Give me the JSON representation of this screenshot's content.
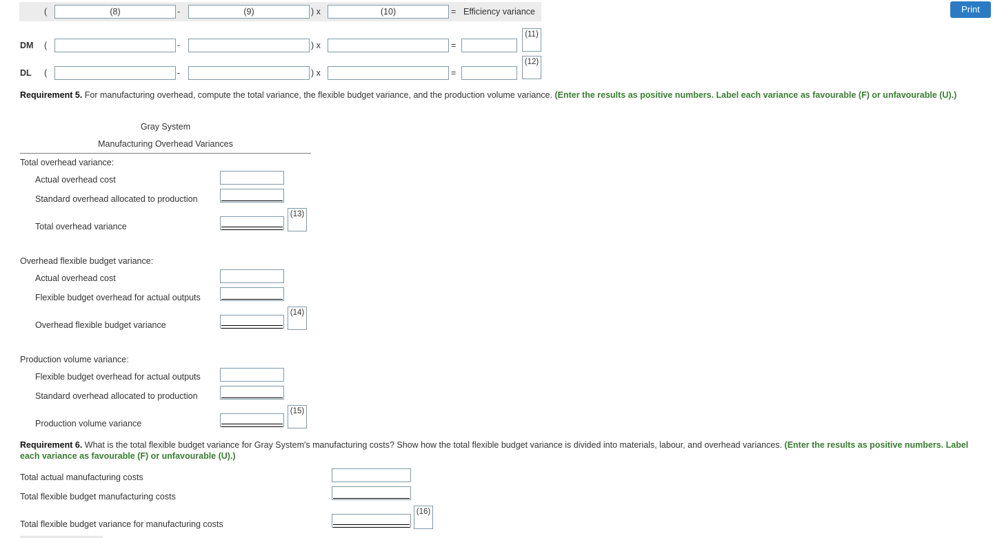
{
  "toolbar": {
    "print_label": "Print"
  },
  "formula": {
    "header": {
      "open_paren": "(",
      "box1": "(8)",
      "minus": "-",
      "box2": "(9)",
      "close_paren_times": ") x",
      "box3": "(10)",
      "equals": "=",
      "result_label": "Efficiency variance"
    },
    "rows": [
      {
        "label": "DM",
        "open_paren": "(",
        "box1": "",
        "minus": "-",
        "box2": "",
        "close_paren_times": ") x",
        "box3": "",
        "equals": "=",
        "box4": "",
        "tag": "(11)"
      },
      {
        "label": "DL",
        "open_paren": "(",
        "box1": "",
        "minus": "-",
        "box2": "",
        "close_paren_times": ") x",
        "box3": "",
        "equals": "=",
        "box4": "",
        "tag": "(12)"
      }
    ]
  },
  "requirement5": {
    "number": "Requirement 5.",
    "text": " For manufacturing overhead, compute the total variance, the flexible budget variance, and the production volume variance. ",
    "instruction": "(Enter the results as positive numbers. Label each variance as favourable (F) or unfavourable (U).)"
  },
  "statement": {
    "company": "Gray System",
    "title": "Manufacturing Overhead Variances",
    "sections": [
      {
        "heading": "Total overhead variance:",
        "rows": [
          {
            "label": "Actual overhead cost",
            "value": "",
            "rule": "none",
            "tag": ""
          },
          {
            "label": "Standard overhead allocated to production",
            "value": "",
            "rule": "single",
            "tag": ""
          },
          {
            "label": "Total overhead variance",
            "value": "",
            "rule": "double",
            "tag": "(13)"
          }
        ]
      },
      {
        "heading": "Overhead flexible budget variance:",
        "rows": [
          {
            "label": "Actual overhead cost",
            "value": "",
            "rule": "none",
            "tag": ""
          },
          {
            "label": "Flexible budget overhead for actual outputs",
            "value": "",
            "rule": "single",
            "tag": ""
          },
          {
            "label": "Overhead flexible budget variance",
            "value": "",
            "rule": "double",
            "tag": "(14)"
          }
        ]
      },
      {
        "heading": "Production volume variance:",
        "rows": [
          {
            "label": "Flexible budget overhead for actual outputs",
            "value": "",
            "rule": "none",
            "tag": ""
          },
          {
            "label": "Standard overhead allocated to production",
            "value": "",
            "rule": "single",
            "tag": ""
          },
          {
            "label": "Production volume variance",
            "value": "",
            "rule": "double",
            "tag": "(15)"
          }
        ]
      }
    ]
  },
  "requirement6": {
    "number": "Requirement 6.",
    "text": " What is the total flexible budget variance for Gray System's manufacturing costs? Show how the total flexible budget variance is divided into materials, labour, and overhead variances. ",
    "instruction": "(Enter the results as positive numbers. Label each variance as favourable (F) or unfavourable (U).)",
    "rows": [
      {
        "label": "Total actual manufacturing costs",
        "value": "",
        "rule": "none",
        "tag": ""
      },
      {
        "label": "Total flexible budget manufacturing costs",
        "value": "",
        "rule": "single",
        "tag": ""
      },
      {
        "label": "Total flexible budget variance for manufacturing costs",
        "value": "",
        "rule": "double",
        "tag": "(16)"
      }
    ]
  },
  "colors": {
    "accent_button": "#2a7bc4",
    "instruction_green": "#3a7d33",
    "input_border": "#7e9aa6",
    "header_band": "#ececec"
  }
}
